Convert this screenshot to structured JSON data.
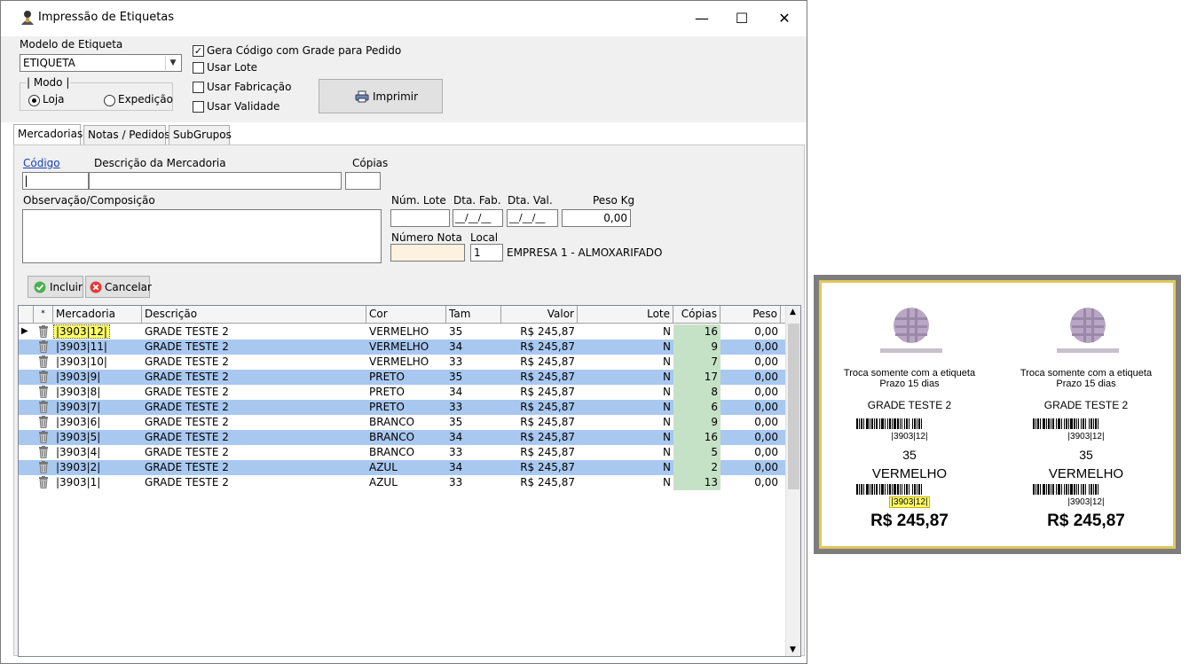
{
  "window": {
    "title": "Impressão de Etiquetas",
    "minimize_glyph": "—",
    "maximize_glyph": "☐",
    "close_glyph": "✕"
  },
  "form": {
    "modelo_label": "Modelo de Etiqueta",
    "modelo_value": "ETIQUETA",
    "modo_label": "| Modo |",
    "radio_loja": "Loja",
    "radio_expedicao": "Expedição",
    "chk_gera": "Gera Código com Grade para Pedido",
    "chk_lote": "Usar Lote",
    "chk_fabricacao": "Usar Fabricação",
    "chk_validade": "Usar Validade",
    "print_button": "Imprimir"
  },
  "tabs": [
    "Mercadorias",
    "Notas / Pedidos",
    "SubGrupos"
  ],
  "entry": {
    "codigo_label": "Código",
    "descricao_label": "Descrição da Mercadoria",
    "copias_label": "Cópias",
    "obs_label": "Observação/Composição",
    "num_lote_label": "Núm. Lote",
    "dta_fab_label": "Dta. Fab.",
    "dta_val_label": "Dta. Val.",
    "peso_label": "Peso Kg",
    "dta_fab_value": "__/__/__",
    "dta_val_value": "__/__/__",
    "peso_value": "0,00",
    "numero_nota_label": "Número Nota",
    "local_label": "Local",
    "local_value": "1",
    "local_desc": "EMPRESA 1 - ALMOXARIFADO",
    "incluir_button": "Incluir",
    "cancelar_button": "Cancelar"
  },
  "grid": {
    "headers": [
      "*",
      "Mercadoria",
      "Descrição",
      "Cor",
      "Tam",
      "Valor",
      "Lote",
      "Cópias",
      "Peso"
    ],
    "rows": [
      {
        "mercadoria": "|3903|12|",
        "descricao": "GRADE TESTE 2",
        "cor": "VERMELHO",
        "tam": "35",
        "valor": "R$ 245,87",
        "lote": "N",
        "copias": "16",
        "peso": "0,00"
      },
      {
        "mercadoria": "|3903|11|",
        "descricao": "GRADE TESTE 2",
        "cor": "VERMELHO",
        "tam": "34",
        "valor": "R$ 245,87",
        "lote": "N",
        "copias": "9",
        "peso": "0,00"
      },
      {
        "mercadoria": "|3903|10|",
        "descricao": "GRADE TESTE 2",
        "cor": "VERMELHO",
        "tam": "33",
        "valor": "R$ 245,87",
        "lote": "N",
        "copias": "7",
        "peso": "0,00"
      },
      {
        "mercadoria": "|3903|9|",
        "descricao": "GRADE TESTE 2",
        "cor": "PRETO",
        "tam": "35",
        "valor": "R$ 245,87",
        "lote": "N",
        "copias": "17",
        "peso": "0,00"
      },
      {
        "mercadoria": "|3903|8|",
        "descricao": "GRADE TESTE 2",
        "cor": "PRETO",
        "tam": "34",
        "valor": "R$ 245,87",
        "lote": "N",
        "copias": "8",
        "peso": "0,00"
      },
      {
        "mercadoria": "|3903|7|",
        "descricao": "GRADE TESTE 2",
        "cor": "PRETO",
        "tam": "33",
        "valor": "R$ 245,87",
        "lote": "N",
        "copias": "6",
        "peso": "0,00"
      },
      {
        "mercadoria": "|3903|6|",
        "descricao": "GRADE TESTE 2",
        "cor": "BRANCO",
        "tam": "35",
        "valor": "R$ 245,87",
        "lote": "N",
        "copias": "9",
        "peso": "0,00"
      },
      {
        "mercadoria": "|3903|5|",
        "descricao": "GRADE TESTE 2",
        "cor": "BRANCO",
        "tam": "34",
        "valor": "R$ 245,87",
        "lote": "N",
        "copias": "16",
        "peso": "0,00"
      },
      {
        "mercadoria": "|3903|4|",
        "descricao": "GRADE TESTE 2",
        "cor": "BRANCO",
        "tam": "33",
        "valor": "R$ 245,87",
        "lote": "N",
        "copias": "5",
        "peso": "0,00"
      },
      {
        "mercadoria": "|3903|2|",
        "descricao": "GRADE TESTE 2",
        "cor": "AZUL",
        "tam": "34",
        "valor": "R$ 245,87",
        "lote": "N",
        "copias": "2",
        "peso": "0,00"
      },
      {
        "mercadoria": "|3903|1|",
        "descricao": "GRADE TESTE 2",
        "cor": "AZUL",
        "tam": "33",
        "valor": "R$ 245,87",
        "lote": "N",
        "copias": "13",
        "peso": "0,00"
      }
    ]
  },
  "preview": {
    "troca": "Troca somente com a etiqueta",
    "prazo": "Prazo 15 dias",
    "produto": "GRADE TESTE 2",
    "codigo": "|3903|12|",
    "tamanho": "35",
    "cor": "VERMELHO",
    "preco": "R$ 245,87"
  },
  "colors": {
    "row_alt": "#a8c8f0",
    "copias_bg": "#c6e2c6",
    "highlight": "#ffff66",
    "frame_gold": "#e2c75a"
  }
}
